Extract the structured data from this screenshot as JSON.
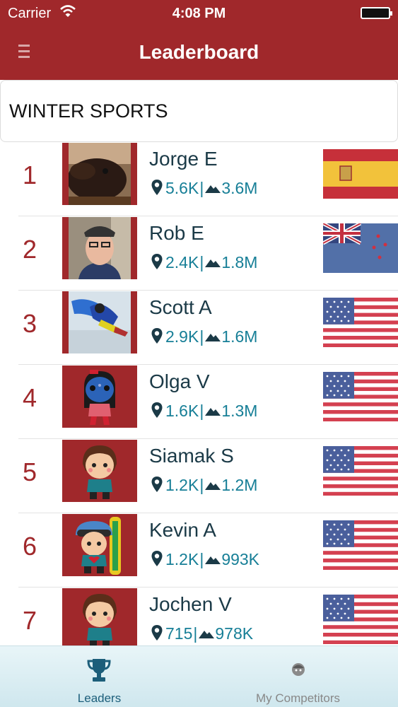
{
  "status_bar": {
    "carrier": "Carrier",
    "time": "4:08 PM"
  },
  "nav": {
    "title": "Leaderboard",
    "menu_icon": "hamburger-menu-icon"
  },
  "section": {
    "title": "WINTER SPORTS"
  },
  "leaders": [
    {
      "rank": "1",
      "name": "Jorge E",
      "checkins": "5.6K",
      "vertical": "3.6M",
      "flag": "spain"
    },
    {
      "rank": "2",
      "name": "Rob E",
      "checkins": "2.4K",
      "vertical": "1.8M",
      "flag": "new-zealand"
    },
    {
      "rank": "3",
      "name": "Scott A",
      "checkins": "2.9K",
      "vertical": "1.6M",
      "flag": "usa"
    },
    {
      "rank": "4",
      "name": "Olga V",
      "checkins": "1.6K",
      "vertical": "1.3M",
      "flag": "usa"
    },
    {
      "rank": "5",
      "name": "Siamak S",
      "checkins": "1.2K",
      "vertical": "1.2M",
      "flag": "usa"
    },
    {
      "rank": "6",
      "name": "Kevin A",
      "checkins": "1.2K",
      "vertical": "993K",
      "flag": "usa"
    },
    {
      "rank": "7",
      "name": "Jochen V",
      "checkins": "715",
      "vertical": "978K",
      "flag": "usa"
    }
  ],
  "tabs": [
    {
      "label": "Leaders",
      "icon": "trophy-icon",
      "selected": true
    },
    {
      "label": "My Competitors",
      "icon": "competitor-face-icon",
      "selected": false
    }
  ],
  "colors": {
    "brand": "#a0282b",
    "stat": "#177f97",
    "name": "#1b3a47"
  }
}
